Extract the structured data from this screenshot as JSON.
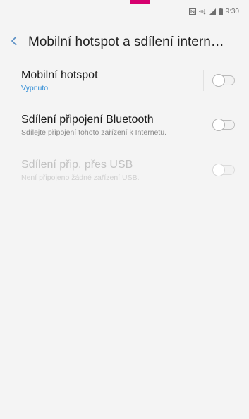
{
  "status_bar": {
    "time": "9:30",
    "icons": [
      "nfc-icon",
      "network-type-icon",
      "signal-icon",
      "battery-icon"
    ]
  },
  "header": {
    "title": "Mobilní hotspot a sdílení intern…",
    "back_icon": "chevron-left-icon"
  },
  "settings": [
    {
      "title": "Mobilní hotspot",
      "subtitle": "Vypnuto",
      "enabled": true,
      "toggle_on": false
    },
    {
      "title": "Sdílení připojení Bluetooth",
      "subtitle": "Sdílejte připojení tohoto zařízení k Internetu.",
      "enabled": true,
      "toggle_on": false
    },
    {
      "title": "Sdílení přip. přes USB",
      "subtitle": "Není připojeno žádné zařízení USB.",
      "enabled": false,
      "toggle_on": false
    }
  ],
  "colors": {
    "accent_top": "#d6006e",
    "link_blue": "#2f8cd6",
    "background": "#f4f4f4"
  }
}
